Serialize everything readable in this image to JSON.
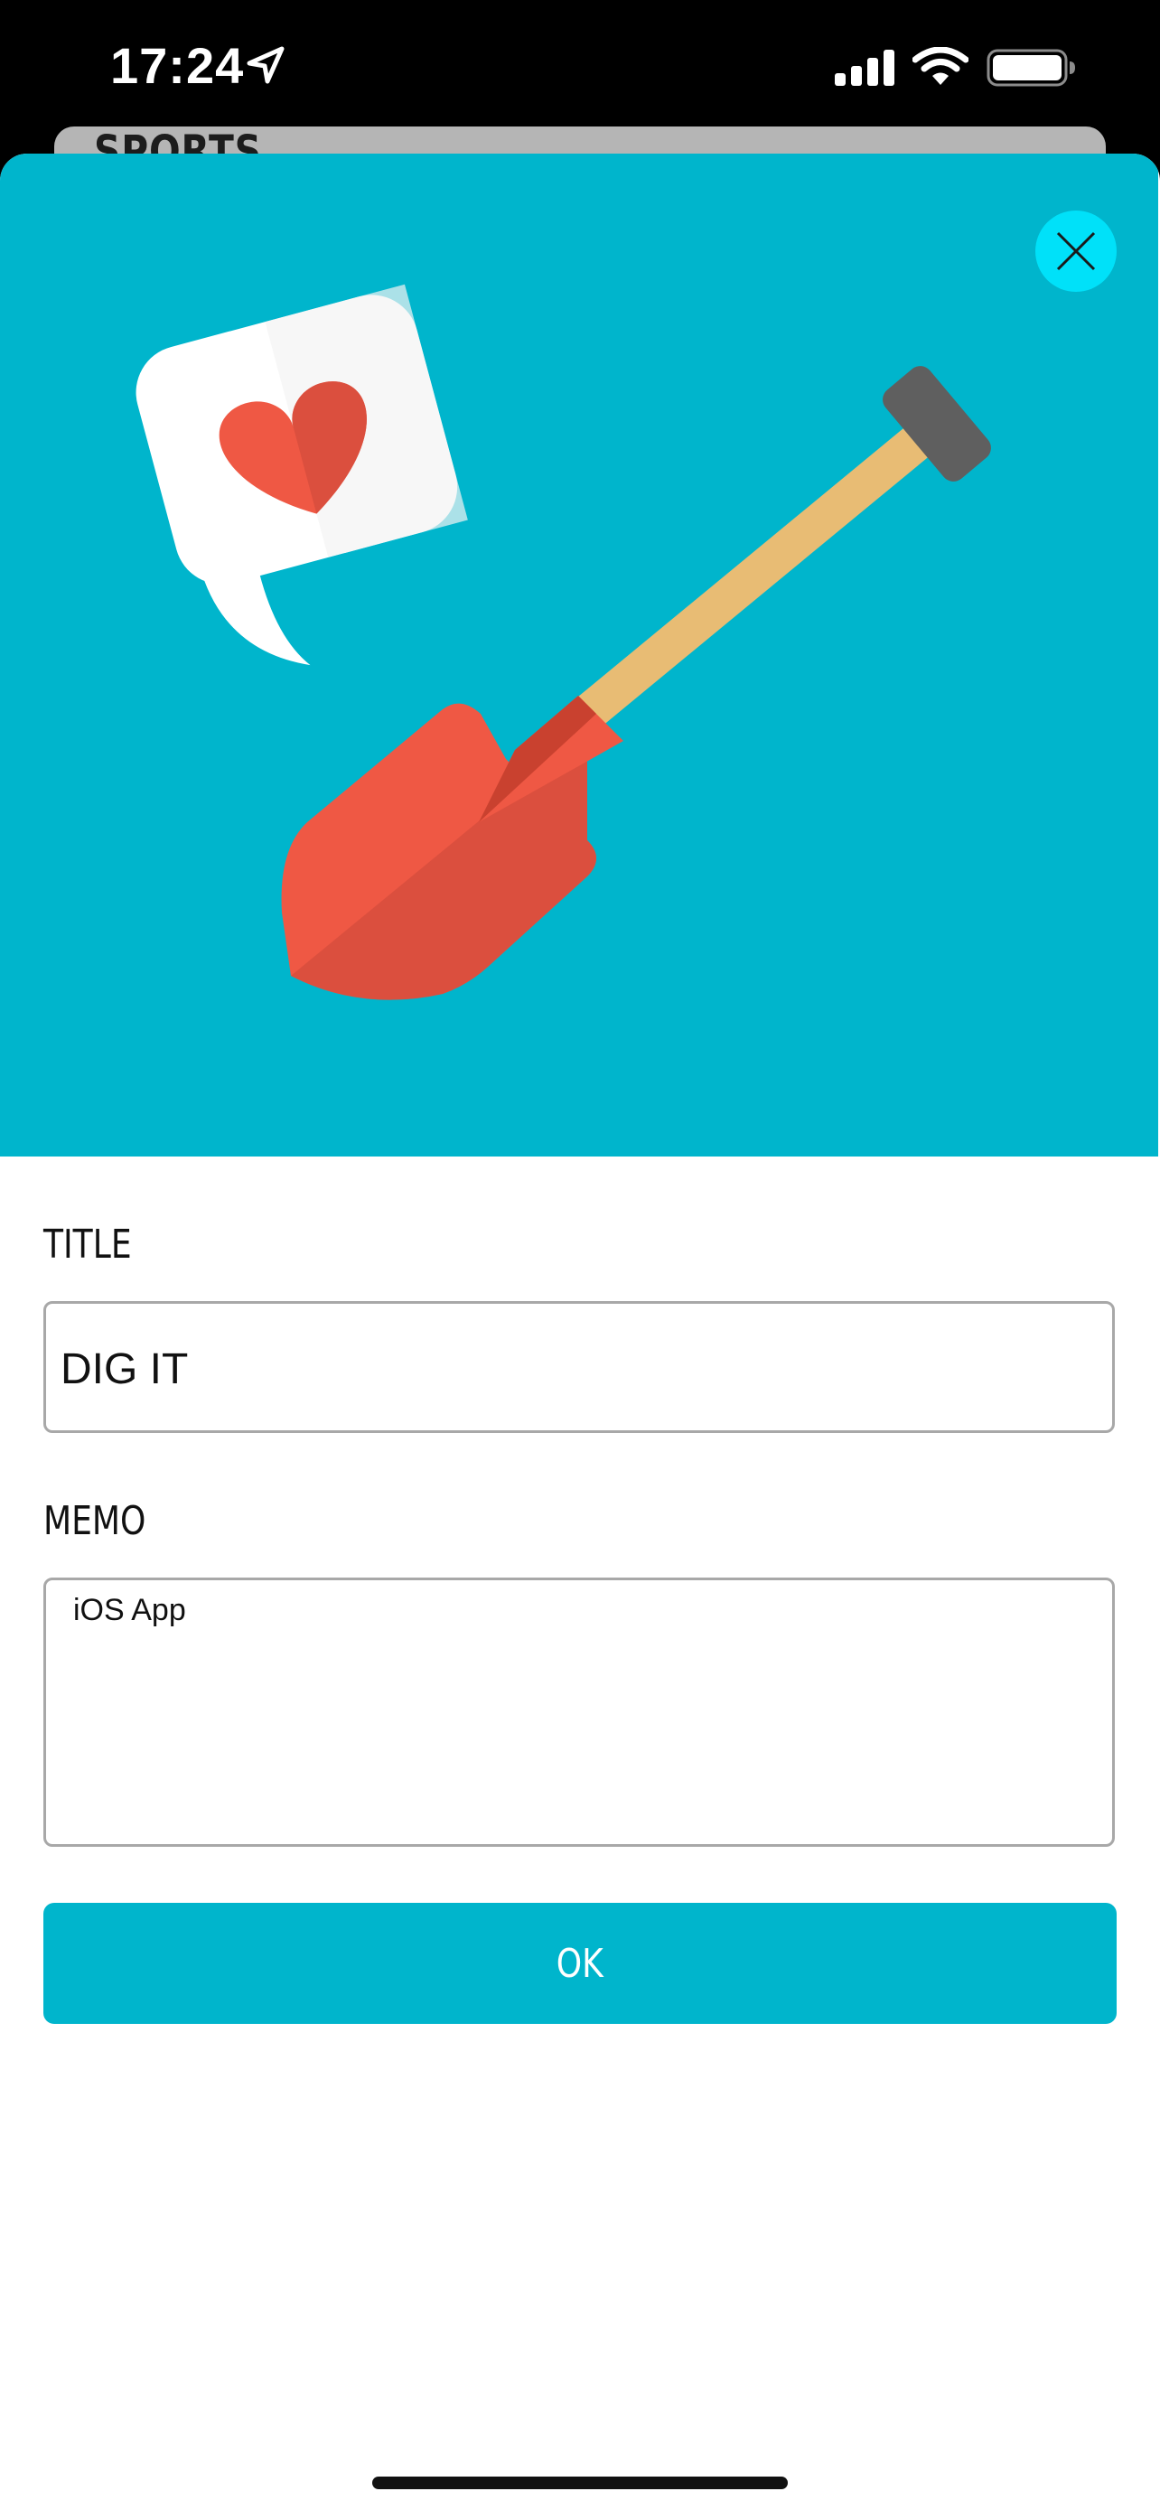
{
  "status_bar": {
    "time": "17:24",
    "icons": [
      "location-arrow-icon",
      "cellular-signal-icon",
      "wifi-icon",
      "battery-icon"
    ]
  },
  "background_card": {
    "label": "SPORTS"
  },
  "hero": {
    "background_color": "#00b5cc",
    "illustration": [
      "heart-speech-bubble-icon",
      "shovel-icon"
    ],
    "close_icon": "close-icon"
  },
  "form": {
    "title_label": "TITLE",
    "title_value": "DIG IT",
    "memo_label": "MEMO",
    "memo_value": "iOS App",
    "ok_label": "OK"
  },
  "colors": {
    "accent": "#00b5cc",
    "close_button": "#00e1f9",
    "shovel_blade": "#ef5844",
    "shovel_handle": "#e8bc74",
    "heart": "#ef5844"
  }
}
